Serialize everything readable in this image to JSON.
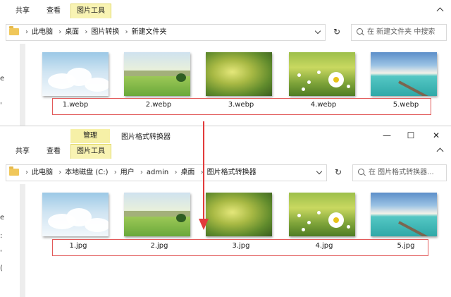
{
  "window1": {
    "ribbon_tabs": [
      "共享",
      "查看",
      "图片工具"
    ],
    "address": [
      "此电脑",
      "桌面",
      "图片转换",
      "新建文件夹"
    ],
    "search_placeholder": "在 新建文件夹 中搜索",
    "files": [
      "1.webp",
      "2.webp",
      "3.webp",
      "4.webp",
      "5.webp"
    ],
    "left_chars": [
      "e",
      "'"
    ]
  },
  "window2": {
    "context_tab": "管理",
    "title": "图片格式转换器",
    "ribbon_tabs": [
      "共享",
      "查看",
      "图片工具"
    ],
    "address": [
      "此电脑",
      "本地磁盘 (C:)",
      "用户",
      "admin",
      "桌面",
      "图片格式转换器"
    ],
    "search_placeholder": "在 图片格式转换器...",
    "files": [
      "1.jpg",
      "2.jpg",
      "3.jpg",
      "4.jpg",
      "5.jpg"
    ],
    "left_chars": [
      "e",
      ":",
      "'",
      "("
    ],
    "controls": {
      "minimize": "—",
      "maximize": "☐",
      "close": "✕"
    }
  },
  "colors": {
    "highlight_box": "#e25a5a",
    "arrow": "#e23b3b",
    "tool_tab": "#f8f3b3"
  },
  "icons": {
    "folder": "folder-icon",
    "refresh": "refresh-icon",
    "search": "search-icon"
  }
}
